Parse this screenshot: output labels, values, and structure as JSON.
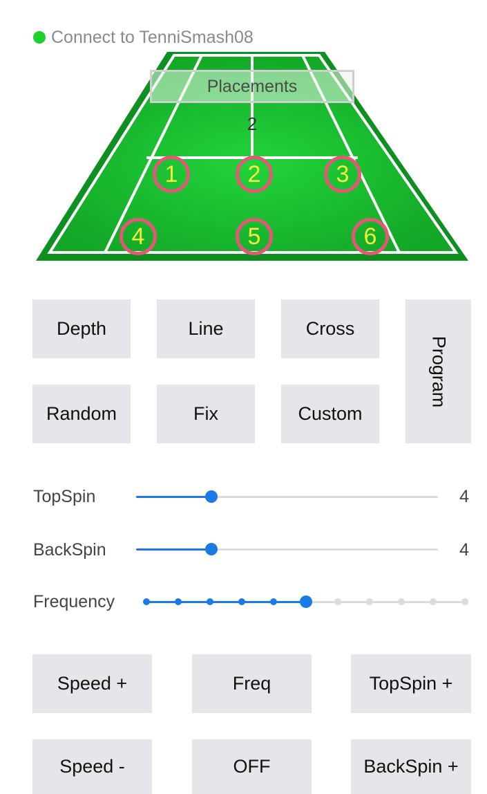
{
  "status": {
    "text": "Connect to TenniSmash08",
    "indicator_color": "#1fd12f"
  },
  "court": {
    "net_label": "Placements",
    "current_spot": "2",
    "spots": [
      "1",
      "2",
      "3",
      "4",
      "5",
      "6"
    ],
    "colors": {
      "grass": "#18b82a",
      "outer": "#0e8f22",
      "lines": "#ffffff",
      "spot_ring": "#e05a78",
      "spot_number": "#f4ef3a"
    }
  },
  "mode_buttons": {
    "depth": "Depth",
    "line": "Line",
    "cross": "Cross",
    "program": "Program",
    "random": "Random",
    "fix": "Fix",
    "custom": "Custom"
  },
  "sliders": {
    "topspin": {
      "label": "TopSpin",
      "value": "4",
      "level": 0.25
    },
    "backspin": {
      "label": "BackSpin",
      "value": "4",
      "level": 0.25
    },
    "frequency": {
      "label": "Frequency",
      "steps": 11,
      "selected_step": 6
    }
  },
  "control_buttons": {
    "speed_up": "Speed +",
    "freq": "Freq",
    "topspin_up": "TopSpin +",
    "speed_down": "Speed -",
    "off": "OFF",
    "backspin_up": "BackSpin +"
  },
  "accent_color": "#1b7be6"
}
